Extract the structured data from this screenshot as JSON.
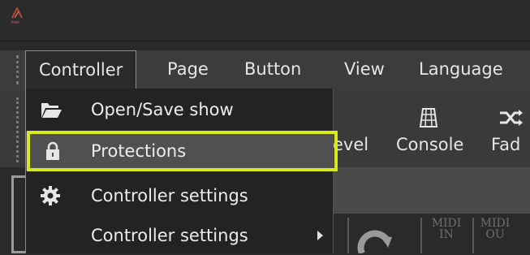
{
  "app": {
    "logo_text": "kiwi"
  },
  "menubar": {
    "items": [
      "Controller",
      "Page",
      "Button",
      "View",
      "Language"
    ]
  },
  "toolbar": {
    "level_label": "evel",
    "console_label": "Console",
    "fader_label": "Fad"
  },
  "dropdown": {
    "items": [
      {
        "label": "Open/Save show",
        "icon": "folder-open-icon"
      },
      {
        "label": "Protections",
        "icon": "lock-icon",
        "highlighted": true
      },
      {
        "label": "Controller settings",
        "icon": "gear-icon"
      },
      {
        "label": "Controller settings",
        "icon": "none",
        "has_submenu": true
      }
    ]
  },
  "lower": {
    "midi_in": [
      "MIDI",
      "IN"
    ],
    "midi_out": [
      "MIDI",
      "OU"
    ]
  },
  "colors": {
    "highlight_border": "#d6ea1e",
    "menu_bg": "#232323",
    "bar_bg": "#3c3c3c"
  }
}
